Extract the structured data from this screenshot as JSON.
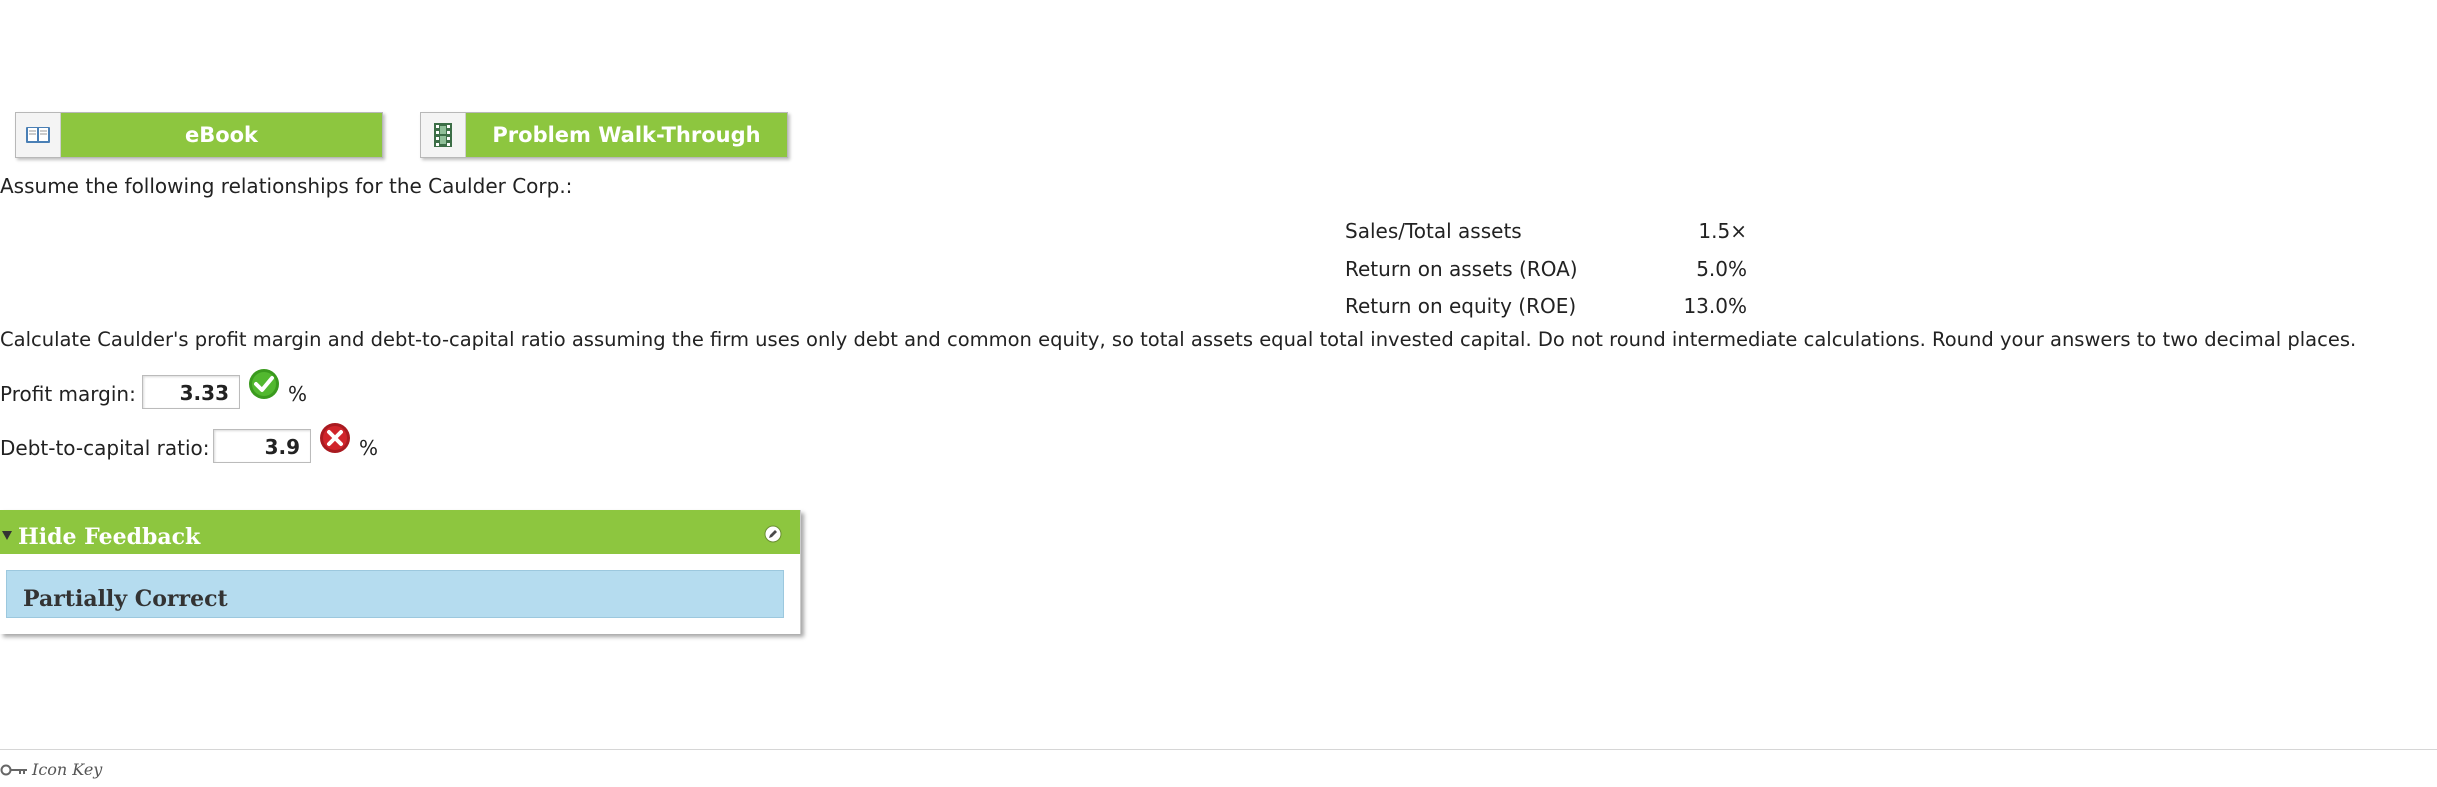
{
  "resources": {
    "ebook_label": "eBook",
    "walkthrough_label": "Problem Walk-Through"
  },
  "question": {
    "intro": "Assume the following relationships for the Caulder Corp.:",
    "ratios": [
      {
        "label": "Sales/Total assets",
        "value": "1.5×"
      },
      {
        "label": "Return on assets (ROA)",
        "value": "5.0%"
      },
      {
        "label": "Return on equity (ROE)",
        "value": "13.0%"
      }
    ],
    "instruction": "Calculate Caulder's profit margin and debt-to-capital ratio assuming the firm uses only debt and common equity, so total assets equal total invested capital. Do not round intermediate calculations. Round your answers to two decimal places."
  },
  "answers": {
    "profit_margin": {
      "label": "Profit margin:",
      "value": "3.33",
      "unit": "%",
      "status": "correct"
    },
    "debt_to_capital": {
      "label": "Debt-to-capital ratio:",
      "value": "3.9",
      "unit": "%",
      "status": "incorrect"
    }
  },
  "feedback": {
    "toggle_label": "Hide Feedback",
    "status_text": "Partially Correct"
  },
  "footer": {
    "icon_key_label": "Icon Key"
  },
  "colors": {
    "accent_green": "#8dc63f",
    "correct_green": "#3a9a1e",
    "incorrect_red": "#d0242b",
    "feedback_blue": "#b5dcef"
  }
}
